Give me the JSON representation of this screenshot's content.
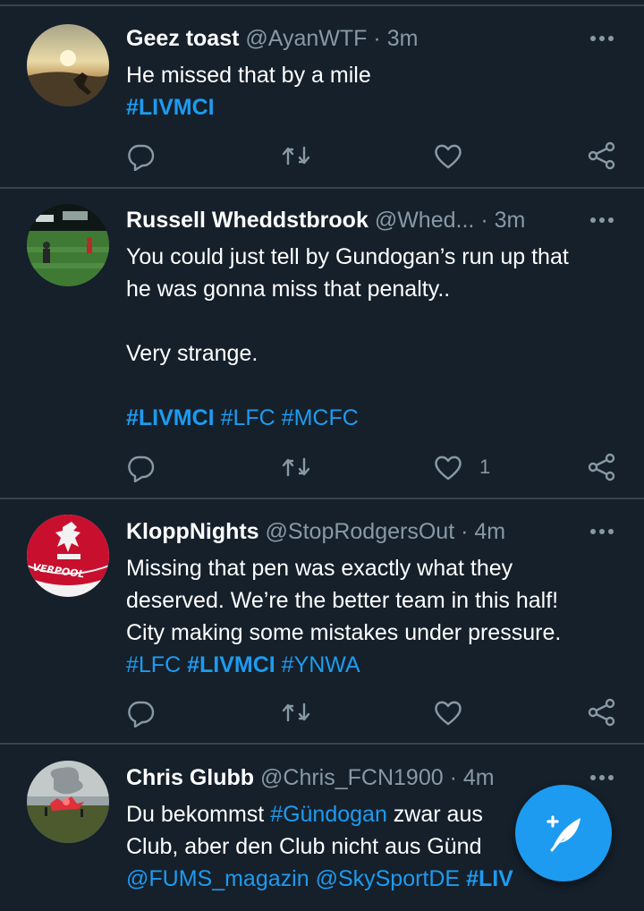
{
  "colors": {
    "background": "#15202b",
    "divider": "#38444d",
    "secondary_text": "#8899a6",
    "accent": "#1d9bf0"
  },
  "tweets": [
    {
      "name": "Geez toast",
      "handle": "@AyanWTF",
      "separator": "·",
      "time": "3m",
      "lines": [
        "He missed that by a mile"
      ],
      "hashtags_line": [
        "#LIVMCI"
      ],
      "like_count": ""
    },
    {
      "name": "Russell Wheddstbrook",
      "handle": "@Whed...",
      "separator": "·",
      "time": "3m",
      "lines": [
        "You could just tell by Gundogan’s run up that",
        "he was gonna miss that penalty..",
        "",
        "Very strange.",
        ""
      ],
      "hashtags_line": [
        "#LIVMCI",
        "#LFC",
        "#MCFC"
      ],
      "like_count": "1"
    },
    {
      "name": "KloppNights",
      "handle": "@StopRodgersOut",
      "separator": "·",
      "time": "4m",
      "lines": [
        "Missing that pen was exactly what they",
        "deserved. We’re the better team in this half!",
        "City making some mistakes under pressure."
      ],
      "hashtags_line": [
        "#LFC",
        "#LIVMCI",
        "#YNWA"
      ],
      "like_count": "",
      "avatar_text": "VERPOOL"
    },
    {
      "name": "Chris Glubb",
      "handle": "@Chris_FCN1900",
      "separator": "·",
      "time": "4m",
      "line1_pre": "Du bekommst ",
      "line1_tag": "#Gündogan",
      "line1_post": " zwar aus",
      "line2": "Club, aber den Club nicht aus Günd",
      "line3_tags": [
        "@FUMS_magazin",
        "@SkySportDE",
        "#LIV"
      ]
    }
  ],
  "icons": {
    "reply": "reply-bubble-icon",
    "retweet": "retweet-arrows-icon",
    "like": "heart-icon",
    "share": "share-icon",
    "more": "more-dots-icon",
    "compose": "compose-feather-icon"
  }
}
